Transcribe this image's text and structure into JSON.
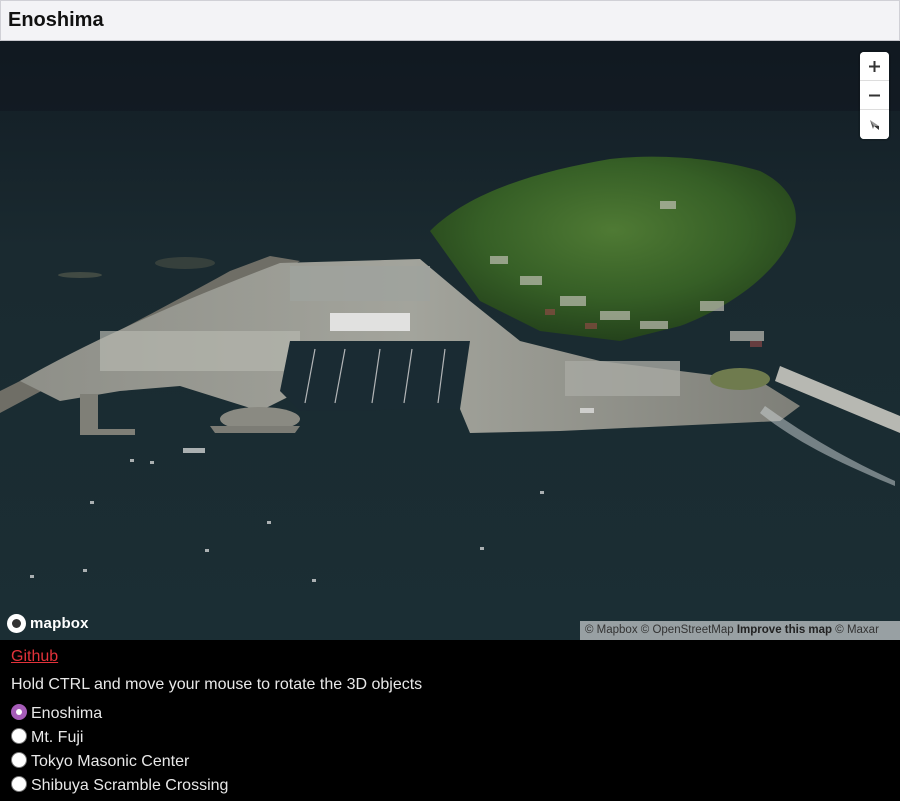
{
  "header": {
    "title": "Enoshima"
  },
  "map": {
    "provider": "mapbox",
    "logo_text": "mapbox",
    "controls": [
      {
        "name": "zoom-in",
        "icon": "plus-icon"
      },
      {
        "name": "zoom-out",
        "icon": "minus-icon"
      },
      {
        "name": "reset-bearing",
        "icon": "compass-icon"
      }
    ],
    "attribution": {
      "mapbox": "© Mapbox",
      "osm": "© OpenStreetMap",
      "improve": "Improve this map",
      "maxar": "© Maxar"
    },
    "imagery": "satellite",
    "colors": {
      "sea": "#16222a",
      "vegetation": "#2f5a22",
      "urban": "#8c8c88"
    }
  },
  "panel": {
    "github_label": "Github",
    "hint": "Hold CTRL and move your mouse to rotate the 3D objects",
    "options": [
      {
        "label": "Enoshima",
        "checked": true
      },
      {
        "label": "Mt. Fuji",
        "checked": false
      },
      {
        "label": "Tokyo Masonic Center",
        "checked": false
      },
      {
        "label": "Shibuya Scramble Crossing",
        "checked": false
      }
    ],
    "colors": {
      "link": "#e2323a",
      "radio_checked": "#a65cb8"
    }
  }
}
